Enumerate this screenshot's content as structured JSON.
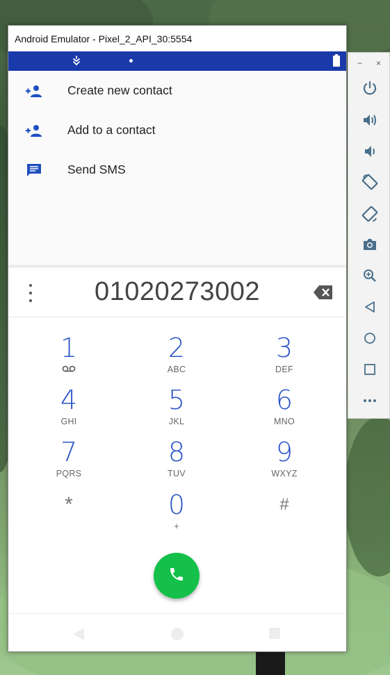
{
  "window": {
    "title": "Android Emulator - Pixel_2_API_30:5554"
  },
  "status_bar": {
    "icons": [
      "notification-icon",
      "dot-icon",
      "battery-icon"
    ]
  },
  "menu": {
    "items": [
      {
        "label": "Create new contact",
        "icon": "add-person-icon"
      },
      {
        "label": "Add to a contact",
        "icon": "add-person-icon"
      },
      {
        "label": "Send SMS",
        "icon": "message-icon"
      }
    ]
  },
  "dialpad": {
    "digits": "01020273002",
    "keys": [
      {
        "num": "1",
        "sub": "voicemail-icon"
      },
      {
        "num": "2",
        "sub": "ABC"
      },
      {
        "num": "3",
        "sub": "DEF"
      },
      {
        "num": "4",
        "sub": "GHI"
      },
      {
        "num": "5",
        "sub": "JKL"
      },
      {
        "num": "6",
        "sub": "MNO"
      },
      {
        "num": "7",
        "sub": "PQRS"
      },
      {
        "num": "8",
        "sub": "TUV"
      },
      {
        "num": "9",
        "sub": "WXYZ"
      },
      {
        "num": "*",
        "sub": ""
      },
      {
        "num": "0",
        "sub": "+"
      },
      {
        "num": "#",
        "sub": ""
      }
    ]
  },
  "toolbar": {
    "minimize": "−",
    "close": "×",
    "buttons": [
      "power-icon",
      "volume-up-icon",
      "volume-down-icon",
      "rotate-left-icon",
      "rotate-right-icon",
      "camera-icon",
      "zoom-icon",
      "back-icon",
      "home-icon",
      "overview-icon",
      "more-icon"
    ]
  },
  "colors": {
    "status_bar": "#1a3aa9",
    "accent": "#2b54c6",
    "call_button": "#14c04a",
    "toolbar_icon": "#4a6f8a"
  }
}
